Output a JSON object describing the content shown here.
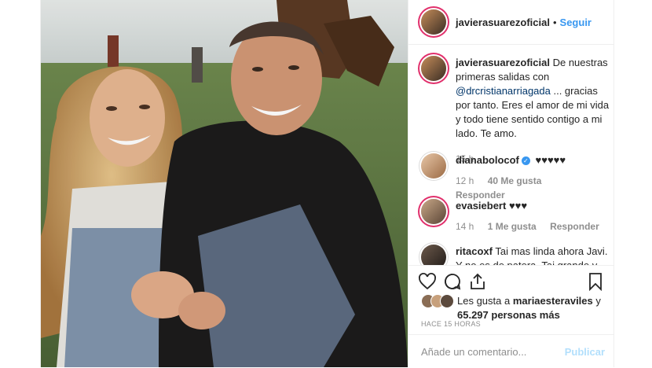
{
  "post": {
    "username": "javierasuarezoficial",
    "follow_label": "Seguir",
    "caption": {
      "username": "javierasuarezoficial",
      "text_before": "De nuestras primeras salidas con",
      "mention": "@drcristianarriagada",
      "text_after": "... gracias por tanto. Eres el amor de mi vida y todo tiene sentido contigo a mi lado. Te amo.",
      "time": "15 h"
    },
    "comments": [
      {
        "username": "dianabolocof",
        "verified": true,
        "text": "♥♥♥♥♥",
        "time": "12 h",
        "likes": "40 Me gusta",
        "reply": "Responder"
      },
      {
        "username": "evasiebert",
        "verified": false,
        "text": "♥♥♥",
        "time": "14 h",
        "likes": "1 Me gusta",
        "reply": "Responder"
      },
      {
        "username": "ritacoxf",
        "verified": false,
        "text": "Tai mas linda ahora Javi. Y no es de patera. Tai grande y",
        "time": "",
        "likes": "",
        "reply": ""
      }
    ],
    "likes_line": {
      "prefix": "Les gusta a",
      "user": "mariaesteraviles",
      "suffix": "y",
      "count": "65.297 personas más"
    },
    "timestamp": "HACE 15 HORAS",
    "add_comment_placeholder": "Añade un comentario...",
    "publish_label": "Publicar"
  },
  "icons": {
    "like": "heart-icon",
    "comment": "comment-icon",
    "share": "share-icon",
    "save": "bookmark-icon"
  },
  "colors": {
    "link_blue": "#3897f0",
    "muted_gray": "#8e8e8e",
    "border": "#efefef"
  }
}
